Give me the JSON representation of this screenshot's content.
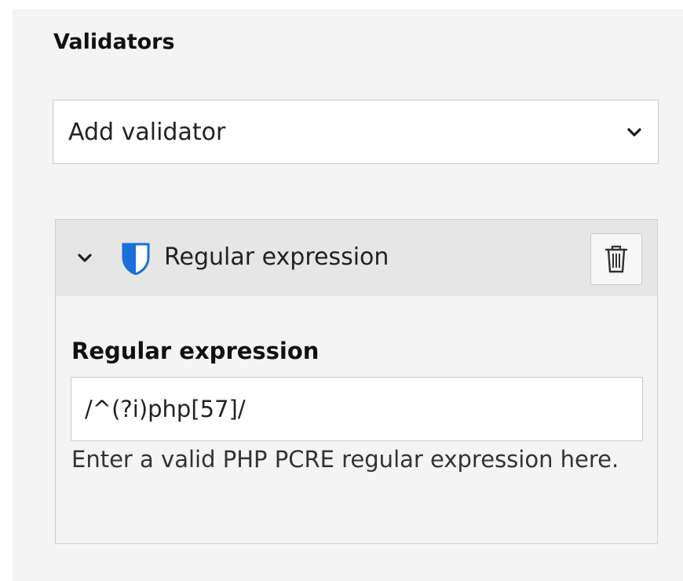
{
  "section": {
    "title": "Validators"
  },
  "add_validator": {
    "selected": "Add validator",
    "chevron_icon": "chevron-down-icon"
  },
  "validator_card": {
    "collapse_icon": "chevron-down-icon",
    "type_icon": "shield-icon",
    "title": "Regular expression",
    "delete_icon": "trash-icon",
    "field": {
      "label": "Regular expression",
      "value": "/^(?i)php[57]/",
      "help": "Enter a valid PHP PCRE regular expression here."
    },
    "colors": {
      "shield_blue": "#1a6fd8",
      "header_bg": "#e6e6e6"
    }
  }
}
